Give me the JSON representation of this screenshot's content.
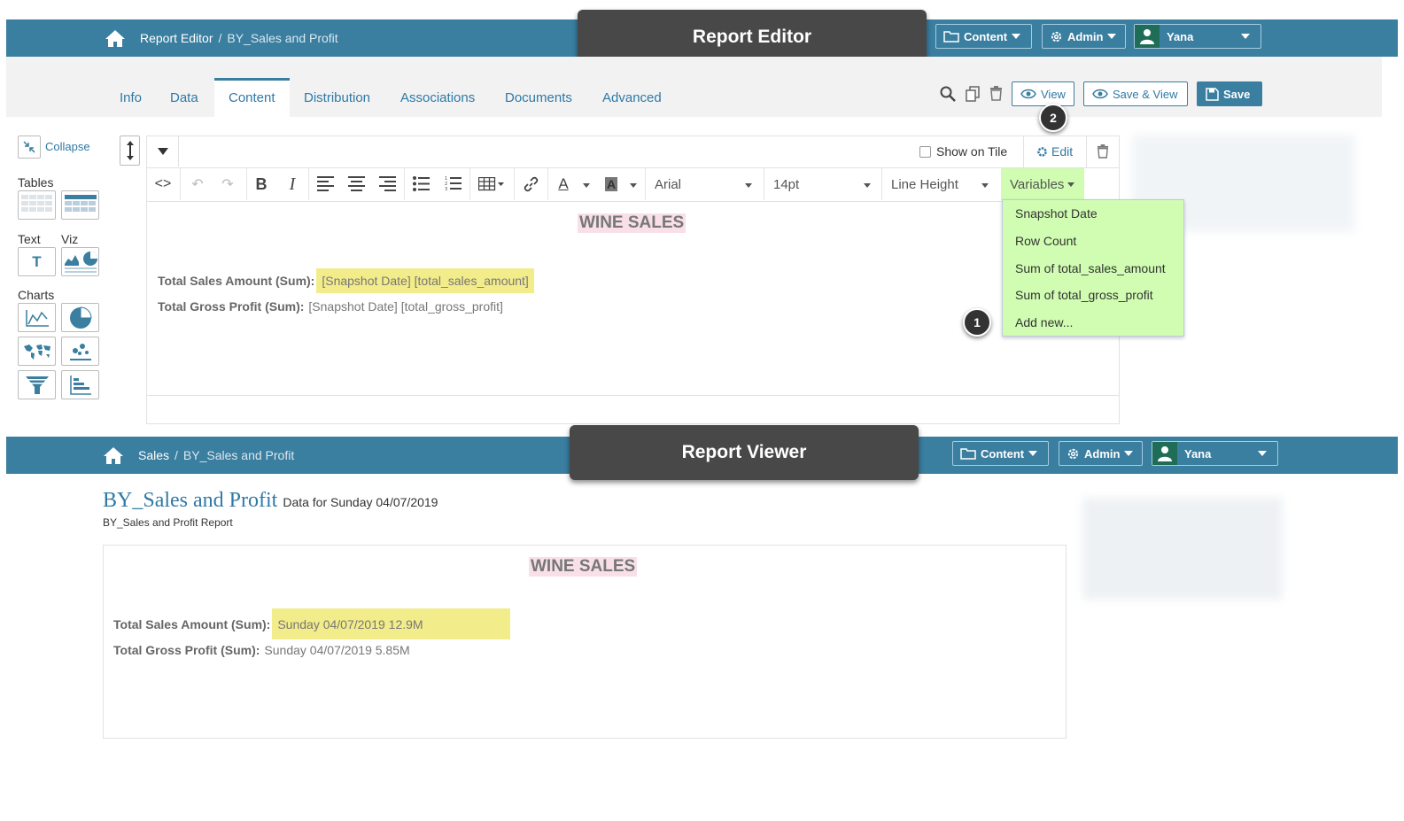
{
  "editor": {
    "breadcrumb": {
      "root": "Report Editor",
      "separator": "/",
      "current": "BY_Sales and Profit"
    },
    "nav": {
      "content": "Content",
      "admin": "Admin",
      "user": "Yana"
    },
    "callout": "Report Editor",
    "tabs": [
      "Info",
      "Data",
      "Content",
      "Distribution",
      "Associations",
      "Documents",
      "Advanced"
    ],
    "active_tab": "Content",
    "actions": {
      "view": "View",
      "save_view": "Save & View",
      "save": "Save"
    },
    "badge_view": "2",
    "badge_menu": "1",
    "sidebar": {
      "collapse": "Collapse",
      "tables": "Tables",
      "text": "Text",
      "viz": "Viz",
      "charts": "Charts"
    },
    "show_on_tile": "Show on Tile",
    "edit": "Edit",
    "toolbar": {
      "font": "Arial",
      "size": "14pt",
      "line_height": "Line Height",
      "variables": "Variables"
    },
    "variables_menu": [
      "Snapshot Date",
      "Row Count",
      "Sum of total_sales_amount",
      "Sum of total_gross_profit",
      "Add new..."
    ],
    "content": {
      "heading": "WINE SALES",
      "line1_label": "Total Sales Amount (Sum):",
      "line1_value": "[Snapshot Date] [total_sales_amount]",
      "line2_label": "Total Gross Profit (Sum):",
      "line2_value": "[Snapshot Date] [total_gross_profit]"
    }
  },
  "viewer": {
    "breadcrumb": {
      "root": "Sales",
      "separator": "/",
      "current": "BY_Sales and Profit"
    },
    "nav": {
      "content": "Content",
      "admin": "Admin",
      "user": "Yana"
    },
    "callout": "Report Viewer",
    "title": "BY_Sales and Profit",
    "subtitle_data": "Data for Sunday 04/07/2019",
    "description": "BY_Sales and Profit Report",
    "content": {
      "heading": "WINE SALES",
      "line1_label": "Total Sales Amount (Sum):",
      "line1_value": "Sunday 04/07/2019 12.9M",
      "line2_label": "Total Gross Profit (Sum):",
      "line2_value": "Sunday 04/07/2019 5.85M"
    }
  },
  "colors": {
    "header": "#3a7ea0",
    "menu": "#d0fdb2",
    "highlight": "#f3ec8a",
    "callout": "#484848"
  }
}
